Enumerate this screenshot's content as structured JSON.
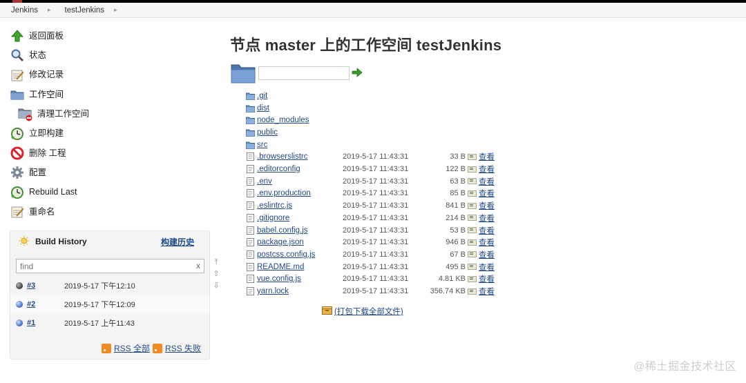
{
  "breadcrumb": {
    "items": [
      "Jenkins",
      "testJenkins"
    ],
    "separator": "▸"
  },
  "side_tasks": [
    {
      "label": "返回面板",
      "icon": "up-arrow-icon"
    },
    {
      "label": "状态",
      "icon": "search-icon"
    },
    {
      "label": "修改记录",
      "icon": "notepad-icon"
    },
    {
      "label": "工作空间",
      "icon": "folder-icon"
    },
    {
      "label": "清理工作空间",
      "icon": "folder-delete-icon"
    },
    {
      "label": "立即构建",
      "icon": "build-clock-icon"
    },
    {
      "label": "删除 工程",
      "icon": "no-entry-icon"
    },
    {
      "label": "配置",
      "icon": "gear-icon"
    },
    {
      "label": "Rebuild Last",
      "icon": "rebuild-clock-icon"
    },
    {
      "label": "重命名",
      "icon": "notepad-icon"
    }
  ],
  "build_history": {
    "title": "Build History",
    "trend_label": "构建历史",
    "search_placeholder": "find",
    "search_clear": "x",
    "builds": [
      {
        "number": "#3",
        "date": "2019-5-17 下午12:10",
        "status": "gray"
      },
      {
        "number": "#2",
        "date": "2019-5-17 下午12:09",
        "status": "blue"
      },
      {
        "number": "#1",
        "date": "2019-5-17 上午11:43",
        "status": "blue"
      }
    ],
    "rss_all": "RSS 全部",
    "rss_failed": "RSS 失败",
    "scroll_controls": [
      "⤒",
      "⇧",
      "⇩"
    ]
  },
  "main": {
    "title": "节点 master 上的工作空间 testJenkins",
    "path_value": "",
    "files": [
      {
        "name": ".git",
        "type": "dir"
      },
      {
        "name": "dist",
        "type": "dir"
      },
      {
        "name": "node_modules",
        "type": "dir"
      },
      {
        "name": "public",
        "type": "dir"
      },
      {
        "name": "src",
        "type": "dir"
      },
      {
        "name": ".browserslistrc",
        "type": "file",
        "date": "2019-5-17 11:43:31",
        "size": "33 B",
        "view": "查看"
      },
      {
        "name": ".editorconfig",
        "type": "file",
        "date": "2019-5-17 11:43:31",
        "size": "122 B",
        "view": "查看"
      },
      {
        "name": ".env",
        "type": "file",
        "date": "2019-5-17 11:43:31",
        "size": "63 B",
        "view": "查看"
      },
      {
        "name": ".env.production",
        "type": "file",
        "date": "2019-5-17 11:43:31",
        "size": "85 B",
        "view": "查看"
      },
      {
        "name": ".eslintrc.js",
        "type": "file",
        "date": "2019-5-17 11:43:31",
        "size": "841 B",
        "view": "查看"
      },
      {
        "name": ".gitignore",
        "type": "file",
        "date": "2019-5-17 11:43:31",
        "size": "214 B",
        "view": "查看"
      },
      {
        "name": "babel.config.js",
        "type": "file",
        "date": "2019-5-17 11:43:31",
        "size": "53 B",
        "view": "查看"
      },
      {
        "name": "package.json",
        "type": "file",
        "date": "2019-5-17 11:43:31",
        "size": "946 B",
        "view": "查看"
      },
      {
        "name": "postcss.config.js",
        "type": "file",
        "date": "2019-5-17 11:43:31",
        "size": "67 B",
        "view": "查看"
      },
      {
        "name": "README.md",
        "type": "file",
        "date": "2019-5-17 11:43:31",
        "size": "495 B",
        "view": "查看"
      },
      {
        "name": "vue.config.js",
        "type": "file",
        "date": "2019-5-17 11:43:31",
        "size": "4.81 KB",
        "view": "查看"
      },
      {
        "name": "yarn.lock",
        "type": "file",
        "date": "2019-5-17 11:43:31",
        "size": "356.74 KB",
        "view": "查看"
      }
    ],
    "download_all": "(打包下载全部文件)"
  },
  "watermark": "@稀土掘金技术社区",
  "colors": {
    "link": "#204a87",
    "panel_bg": "#f4f4f4",
    "rss_orange": "#f08a24",
    "go_green": "#3a9a2a"
  }
}
